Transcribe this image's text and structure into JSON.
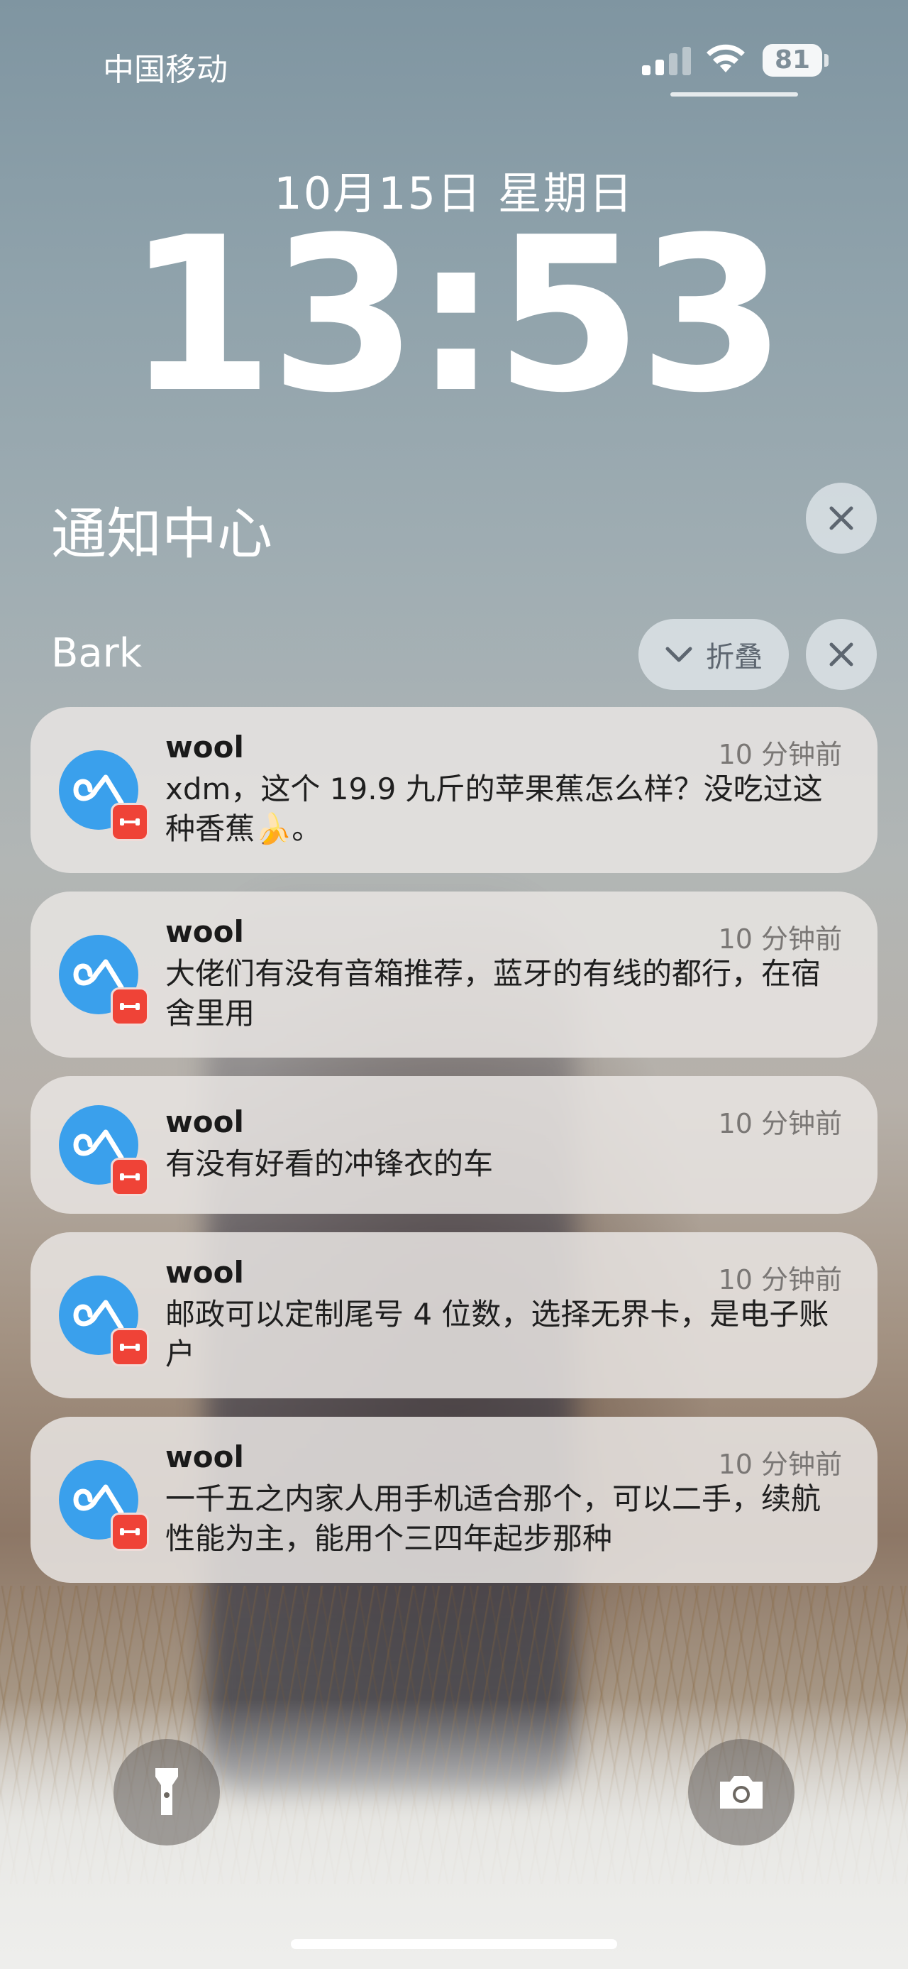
{
  "status_bar": {
    "carrier": "中国移动",
    "battery": "81"
  },
  "lock": {
    "date": "10月15日 星期日",
    "time": "13:53"
  },
  "notification_center": {
    "title": "通知中心",
    "group": {
      "name": "Bark",
      "collapse_label": "折叠"
    }
  },
  "notifications": [
    {
      "title": "wool",
      "time": "10 分钟前",
      "body": "xdm，这个 19.9 九斤的苹果蕉怎么样？没吃过这种香蕉🍌。"
    },
    {
      "title": "wool",
      "time": "10 分钟前",
      "body": "大佬们有没有音箱推荐，蓝牙的有线的都行，在宿舍里用"
    },
    {
      "title": "wool",
      "time": "10 分钟前",
      "body": "有没有好看的冲锋衣的车"
    },
    {
      "title": "wool",
      "time": "10 分钟前",
      "body": "邮政可以定制尾号 4 位数，选择无界卡，是电子账户"
    },
    {
      "title": "wool",
      "time": "10 分钟前",
      "body": "一千五之内家人用手机适合那个，可以二手，续航性能为主，能用个三四年起步那种"
    }
  ],
  "icons": {
    "signal": "cellular-signal-icon",
    "wifi": "wifi-icon",
    "close": "close-icon",
    "collapse": "chevron-down-icon",
    "app": "bark-app-icon",
    "badge": "bark-badge-icon",
    "flashlight": "flashlight-icon",
    "camera": "camera-icon"
  },
  "colors": {
    "app_icon": "#3aa0ec",
    "badge": "#ef4337"
  }
}
